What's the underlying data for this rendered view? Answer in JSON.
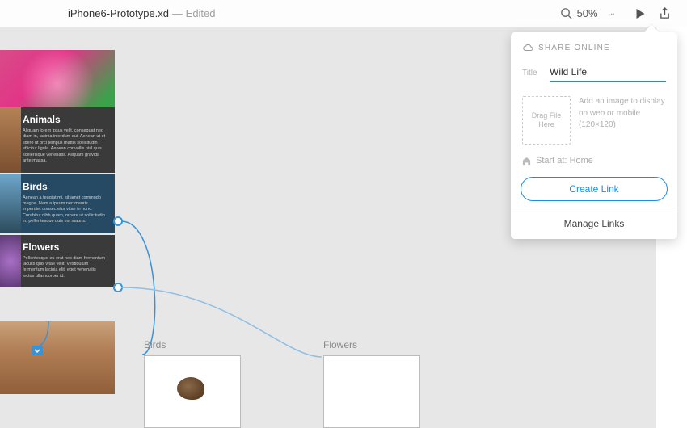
{
  "header": {
    "file_title": "iPhone6-Prototype.xd",
    "status": "— Edited",
    "zoom_level": "50%"
  },
  "device": {
    "sections": {
      "animals": {
        "title": "Animals",
        "body": "Aliquam lorem ipsus velit, consequat nec diam in, lacinia interdum dui. Aenean ut et libero ut orci tempus mattis sollicitudin efficitur ligula. Aenean convallis nisl quis scelerisque venenatis. Aliquam gravida ante massa."
      },
      "birds": {
        "title": "Birds",
        "body": "Aenean a feugiat mi, sit amet commodo magna. Nam a ipsum nec mauris imperdiet consectetur vitae in nunc. Curabitur nibh quam, ornare ut sollicitudin in, pellentesque quis est mauris."
      },
      "flowers": {
        "title": "Flowers",
        "body": "Pellentesque eu erat nec diam fermentum iaculis quis vitae velit. Vestibulum fermentum lacinia elit, eget venenatis lectus ullamcorper id."
      }
    }
  },
  "artboards": {
    "birds_label": "Birds",
    "flowers_label": "Flowers"
  },
  "share": {
    "heading": "SHARE ONLINE",
    "title_label": "Title",
    "title_value": "Wild Life",
    "dropzone_text": "Drag File Here",
    "hint_text": "Add an image to display on web or mobile (120×120)",
    "start_at_label": "Start at: Home",
    "create_link_label": "Create Link",
    "manage_links_label": "Manage Links"
  }
}
